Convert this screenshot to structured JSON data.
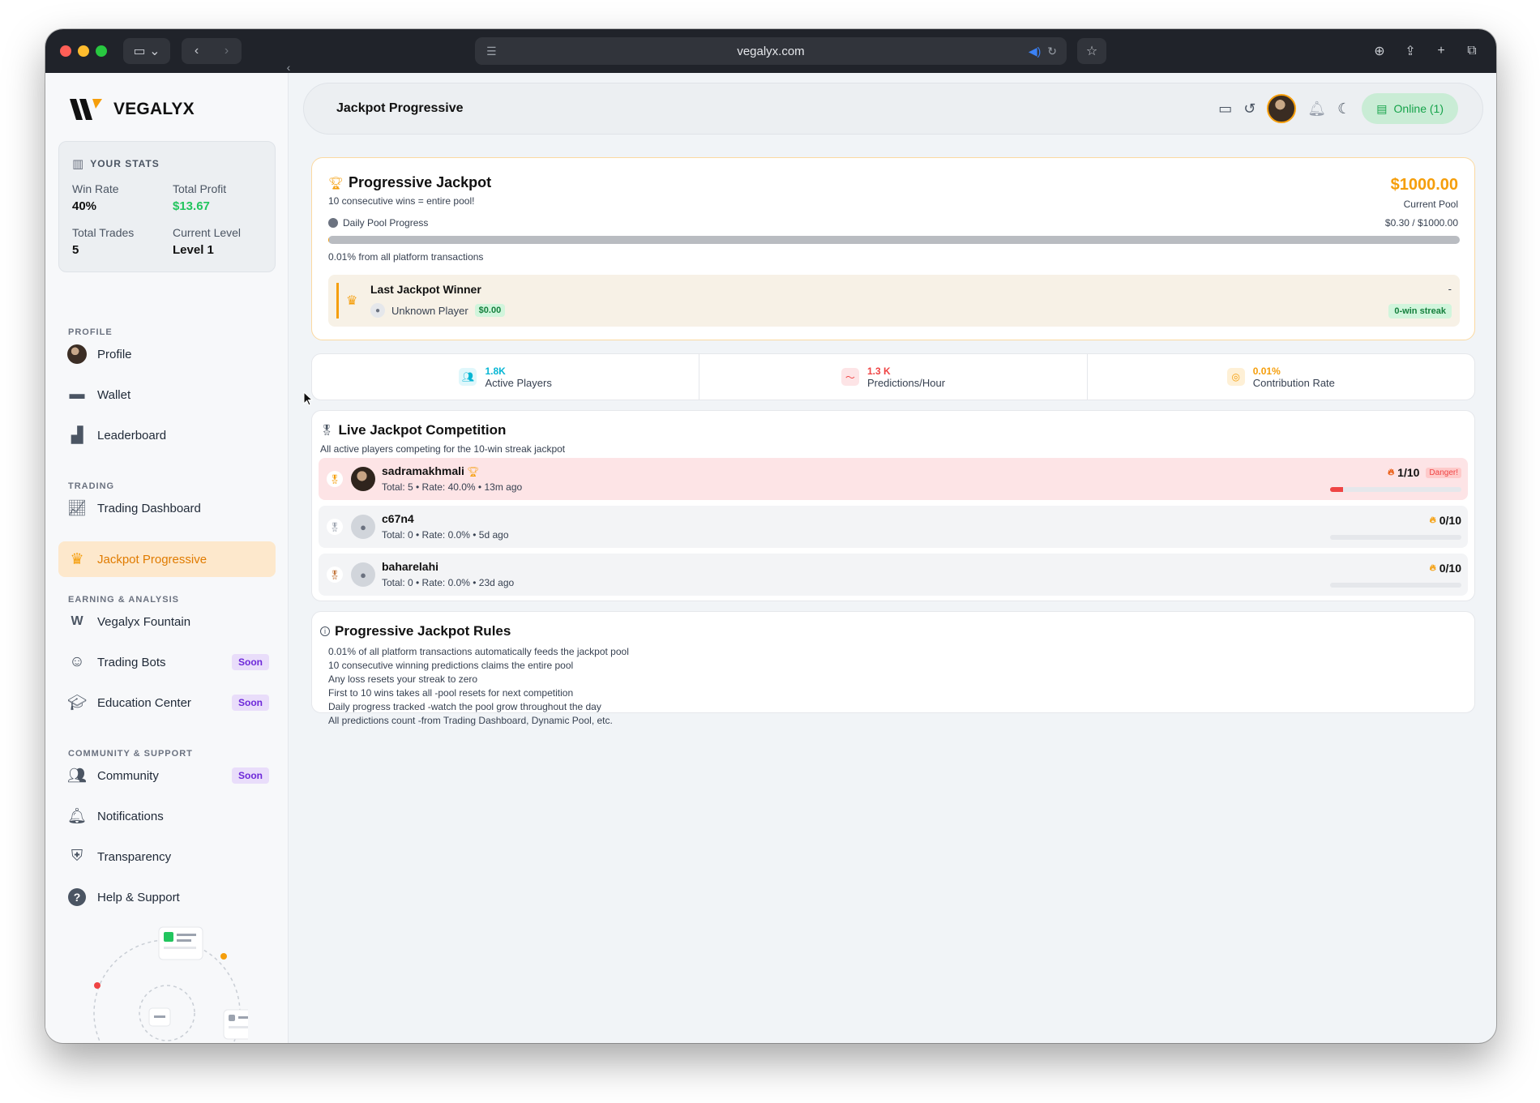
{
  "browser": {
    "url": "vegalyx.com"
  },
  "brand": {
    "name": "VEGALYX"
  },
  "stats": {
    "heading": "YOUR STATS",
    "win_rate_label": "Win Rate",
    "win_rate": "40%",
    "total_profit_label": "Total Profit",
    "total_profit": "$13.67",
    "total_trades_label": "Total Trades",
    "total_trades": "5",
    "current_level_label": "Current Level",
    "current_level": "Level 1"
  },
  "sidebar": {
    "sections": {
      "profile": "PROFILE",
      "trading": "TRADING",
      "earning": "EARNING & ANALYSIS",
      "community": "COMMUNITY & SUPPORT"
    },
    "items": [
      {
        "label": "Profile",
        "icon": "avatar"
      },
      {
        "label": "Wallet",
        "icon": "wallet-icon"
      },
      {
        "label": "Leaderboard",
        "icon": "leaderboard-icon"
      },
      {
        "label": "Trading Dashboard",
        "icon": "chart-icon"
      },
      {
        "label": "Jackpot Progressive",
        "icon": "crown-icon",
        "active": true
      },
      {
        "label": "Vegalyx Fountain",
        "icon": "vegalyx-icon"
      },
      {
        "label": "Trading Bots",
        "icon": "robot-icon",
        "badge": "Soon"
      },
      {
        "label": "Education Center",
        "icon": "graduation-cap-icon",
        "badge": "Soon"
      },
      {
        "label": "Community",
        "icon": "users-icon",
        "badge": "Soon"
      },
      {
        "label": "Notifications",
        "icon": "bell-icon"
      },
      {
        "label": "Transparency",
        "icon": "shield-icon"
      },
      {
        "label": "Help & Support",
        "icon": "help-icon"
      }
    ]
  },
  "header": {
    "title": "Jackpot Progressive",
    "online_label": "Online (1)"
  },
  "jackpot": {
    "title": "Progressive Jackpot",
    "subtitle": "10 consecutive wins = entire pool!",
    "amount": "$1000.00",
    "amount_label": "Current Pool",
    "pool_label": "Daily Pool Progress",
    "pool_value": "$0.30 / $1000.00",
    "pool_progress": 0.0003,
    "contribution_note": "0.01% from all platform transactions",
    "last_winner_title": "Last Jackpot Winner",
    "last_winner_name": "Unknown Player",
    "last_winner_prize": "$0.00",
    "last_winner_date": "-",
    "last_winner_streak": "0-win streak"
  },
  "metrics": [
    {
      "value": "1.8K",
      "label": "Active Players",
      "color": "#06b6d4",
      "icon": "users-icon"
    },
    {
      "value": "1.3 K",
      "label": "Predictions/Hour",
      "color": "#ef4444",
      "icon": "activity-icon"
    },
    {
      "value": "0.01%",
      "label": "Contribution Rate",
      "color": "#f59e0b",
      "icon": "coins-icon"
    }
  ],
  "competition": {
    "title": "Live Jackpot Competition",
    "subtitle": "All active players competing for the 10-win streak jackpot",
    "players": [
      {
        "name": "sadramakhmali",
        "meta": "Total: 5 • Rate: 40.0% • 13m ago",
        "score": "1/10",
        "badge": "Danger!",
        "progress": 0.1
      },
      {
        "name": "c67n4",
        "meta": "Total: 0 • Rate: 0.0% • 5d ago",
        "score": "0/10",
        "progress": 0
      },
      {
        "name": "baharelahi",
        "meta": "Total: 0 • Rate: 0.0% • 23d ago",
        "score": "0/10",
        "progress": 0
      }
    ]
  },
  "rules": {
    "title": "Progressive Jackpot Rules",
    "items": [
      "0.01% of all platform transactions automatically feeds the jackpot pool",
      "10 consecutive winning predictions claims the entire pool",
      "Any loss resets your streak to zero",
      "First to 10 wins takes all -pool resets for next competition",
      "Daily progress tracked -watch the pool grow throughout the day",
      "All predictions count -from Trading Dashboard, Dynamic Pool, etc."
    ]
  }
}
